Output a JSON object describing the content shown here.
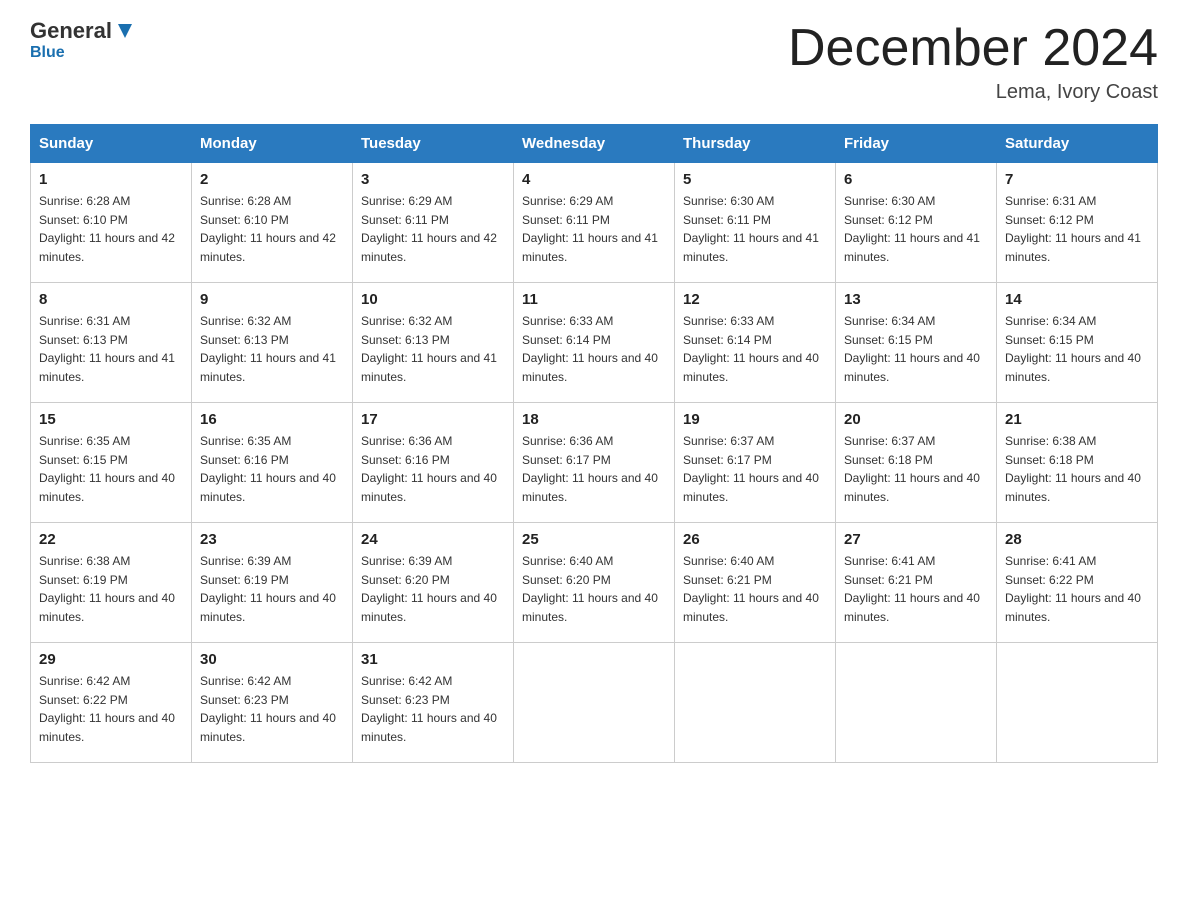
{
  "header": {
    "logo_general": "General",
    "logo_blue": "Blue",
    "month_title": "December 2024",
    "subtitle": "Lema, Ivory Coast"
  },
  "weekdays": [
    "Sunday",
    "Monday",
    "Tuesday",
    "Wednesday",
    "Thursday",
    "Friday",
    "Saturday"
  ],
  "weeks": [
    [
      {
        "day": "1",
        "sunrise": "6:28 AM",
        "sunset": "6:10 PM",
        "daylight": "11 hours and 42 minutes."
      },
      {
        "day": "2",
        "sunrise": "6:28 AM",
        "sunset": "6:10 PM",
        "daylight": "11 hours and 42 minutes."
      },
      {
        "day": "3",
        "sunrise": "6:29 AM",
        "sunset": "6:11 PM",
        "daylight": "11 hours and 42 minutes."
      },
      {
        "day": "4",
        "sunrise": "6:29 AM",
        "sunset": "6:11 PM",
        "daylight": "11 hours and 41 minutes."
      },
      {
        "day": "5",
        "sunrise": "6:30 AM",
        "sunset": "6:11 PM",
        "daylight": "11 hours and 41 minutes."
      },
      {
        "day": "6",
        "sunrise": "6:30 AM",
        "sunset": "6:12 PM",
        "daylight": "11 hours and 41 minutes."
      },
      {
        "day": "7",
        "sunrise": "6:31 AM",
        "sunset": "6:12 PM",
        "daylight": "11 hours and 41 minutes."
      }
    ],
    [
      {
        "day": "8",
        "sunrise": "6:31 AM",
        "sunset": "6:13 PM",
        "daylight": "11 hours and 41 minutes."
      },
      {
        "day": "9",
        "sunrise": "6:32 AM",
        "sunset": "6:13 PM",
        "daylight": "11 hours and 41 minutes."
      },
      {
        "day": "10",
        "sunrise": "6:32 AM",
        "sunset": "6:13 PM",
        "daylight": "11 hours and 41 minutes."
      },
      {
        "day": "11",
        "sunrise": "6:33 AM",
        "sunset": "6:14 PM",
        "daylight": "11 hours and 40 minutes."
      },
      {
        "day": "12",
        "sunrise": "6:33 AM",
        "sunset": "6:14 PM",
        "daylight": "11 hours and 40 minutes."
      },
      {
        "day": "13",
        "sunrise": "6:34 AM",
        "sunset": "6:15 PM",
        "daylight": "11 hours and 40 minutes."
      },
      {
        "day": "14",
        "sunrise": "6:34 AM",
        "sunset": "6:15 PM",
        "daylight": "11 hours and 40 minutes."
      }
    ],
    [
      {
        "day": "15",
        "sunrise": "6:35 AM",
        "sunset": "6:15 PM",
        "daylight": "11 hours and 40 minutes."
      },
      {
        "day": "16",
        "sunrise": "6:35 AM",
        "sunset": "6:16 PM",
        "daylight": "11 hours and 40 minutes."
      },
      {
        "day": "17",
        "sunrise": "6:36 AM",
        "sunset": "6:16 PM",
        "daylight": "11 hours and 40 minutes."
      },
      {
        "day": "18",
        "sunrise": "6:36 AM",
        "sunset": "6:17 PM",
        "daylight": "11 hours and 40 minutes."
      },
      {
        "day": "19",
        "sunrise": "6:37 AM",
        "sunset": "6:17 PM",
        "daylight": "11 hours and 40 minutes."
      },
      {
        "day": "20",
        "sunrise": "6:37 AM",
        "sunset": "6:18 PM",
        "daylight": "11 hours and 40 minutes."
      },
      {
        "day": "21",
        "sunrise": "6:38 AM",
        "sunset": "6:18 PM",
        "daylight": "11 hours and 40 minutes."
      }
    ],
    [
      {
        "day": "22",
        "sunrise": "6:38 AM",
        "sunset": "6:19 PM",
        "daylight": "11 hours and 40 minutes."
      },
      {
        "day": "23",
        "sunrise": "6:39 AM",
        "sunset": "6:19 PM",
        "daylight": "11 hours and 40 minutes."
      },
      {
        "day": "24",
        "sunrise": "6:39 AM",
        "sunset": "6:20 PM",
        "daylight": "11 hours and 40 minutes."
      },
      {
        "day": "25",
        "sunrise": "6:40 AM",
        "sunset": "6:20 PM",
        "daylight": "11 hours and 40 minutes."
      },
      {
        "day": "26",
        "sunrise": "6:40 AM",
        "sunset": "6:21 PM",
        "daylight": "11 hours and 40 minutes."
      },
      {
        "day": "27",
        "sunrise": "6:41 AM",
        "sunset": "6:21 PM",
        "daylight": "11 hours and 40 minutes."
      },
      {
        "day": "28",
        "sunrise": "6:41 AM",
        "sunset": "6:22 PM",
        "daylight": "11 hours and 40 minutes."
      }
    ],
    [
      {
        "day": "29",
        "sunrise": "6:42 AM",
        "sunset": "6:22 PM",
        "daylight": "11 hours and 40 minutes."
      },
      {
        "day": "30",
        "sunrise": "6:42 AM",
        "sunset": "6:23 PM",
        "daylight": "11 hours and 40 minutes."
      },
      {
        "day": "31",
        "sunrise": "6:42 AM",
        "sunset": "6:23 PM",
        "daylight": "11 hours and 40 minutes."
      },
      null,
      null,
      null,
      null
    ]
  ]
}
